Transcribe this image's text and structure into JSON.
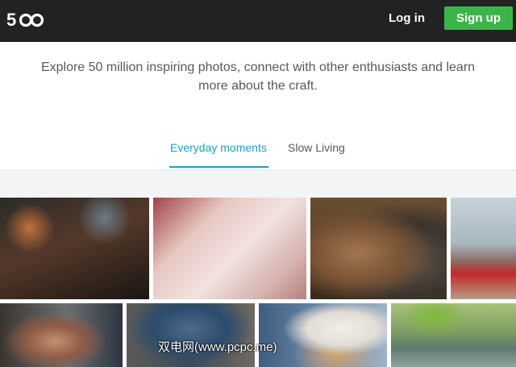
{
  "header": {
    "logo_text": "500",
    "login_label": "Log in",
    "signup_label": "Sign up",
    "background_color": "#222222",
    "signup_color": "#3bb54a"
  },
  "intro": {
    "text": "Explore 50 million inspiring photos, connect with other enthusiasts and learn more about the craft."
  },
  "tabs": [
    {
      "label": "Everyday moments",
      "active": true
    },
    {
      "label": "Slow Living",
      "active": false
    }
  ],
  "accent_color": "#1ba0c8",
  "photos": [
    {
      "description": "cafe-drinks"
    },
    {
      "description": "pink-bicycle"
    },
    {
      "description": "dog-and-cat"
    },
    {
      "description": "eiffel-tower-portrait"
    },
    {
      "description": "girl-portrait"
    },
    {
      "description": "camera-person"
    },
    {
      "description": "snow-woman"
    },
    {
      "description": "kids-by-lake"
    }
  ],
  "watermark": "双电网(www.pcpc.me)"
}
